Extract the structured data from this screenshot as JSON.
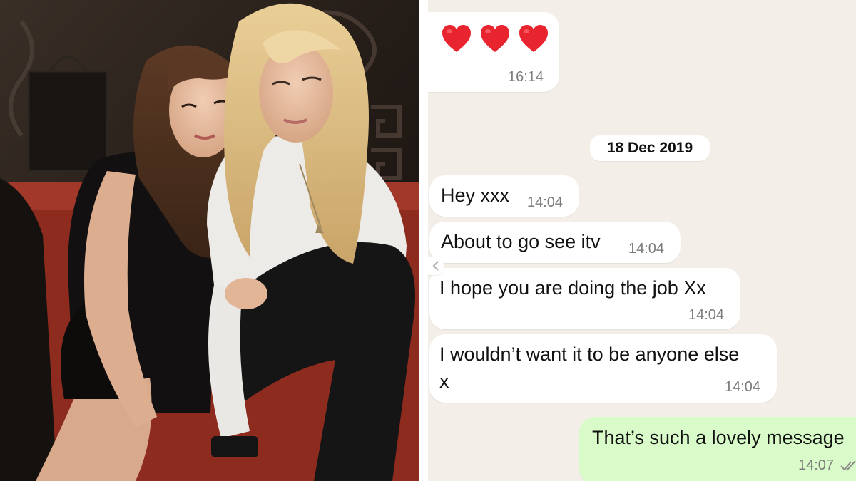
{
  "chat": {
    "first_message": {
      "content": "❤️❤️❤️",
      "hearts": [
        "heart-icon",
        "heart-icon",
        "heart-icon"
      ],
      "time": "16:14"
    },
    "date_separator": "18 Dec 2019",
    "messages": [
      {
        "text": "Hey xxx",
        "time": "14:04"
      },
      {
        "text": "About to go see itv",
        "time": "14:04"
      },
      {
        "text": "I hope  you are doing the job Xx",
        "time": "14:04"
      },
      {
        "lines": [
          "I wouldn’t want it to be anyone else",
          "x"
        ],
        "time": "14:04"
      }
    ],
    "sent_message": {
      "text": "That’s such a lovely message",
      "time": "14:07",
      "status_icon": "double-check-icon"
    }
  },
  "colors": {
    "chat_background": "#f3efe8",
    "incoming_bubble": "#ffffff",
    "outgoing_bubble": "#d9fbc9",
    "heart": "#e8242f",
    "timestamp": "#7c7c7c"
  }
}
